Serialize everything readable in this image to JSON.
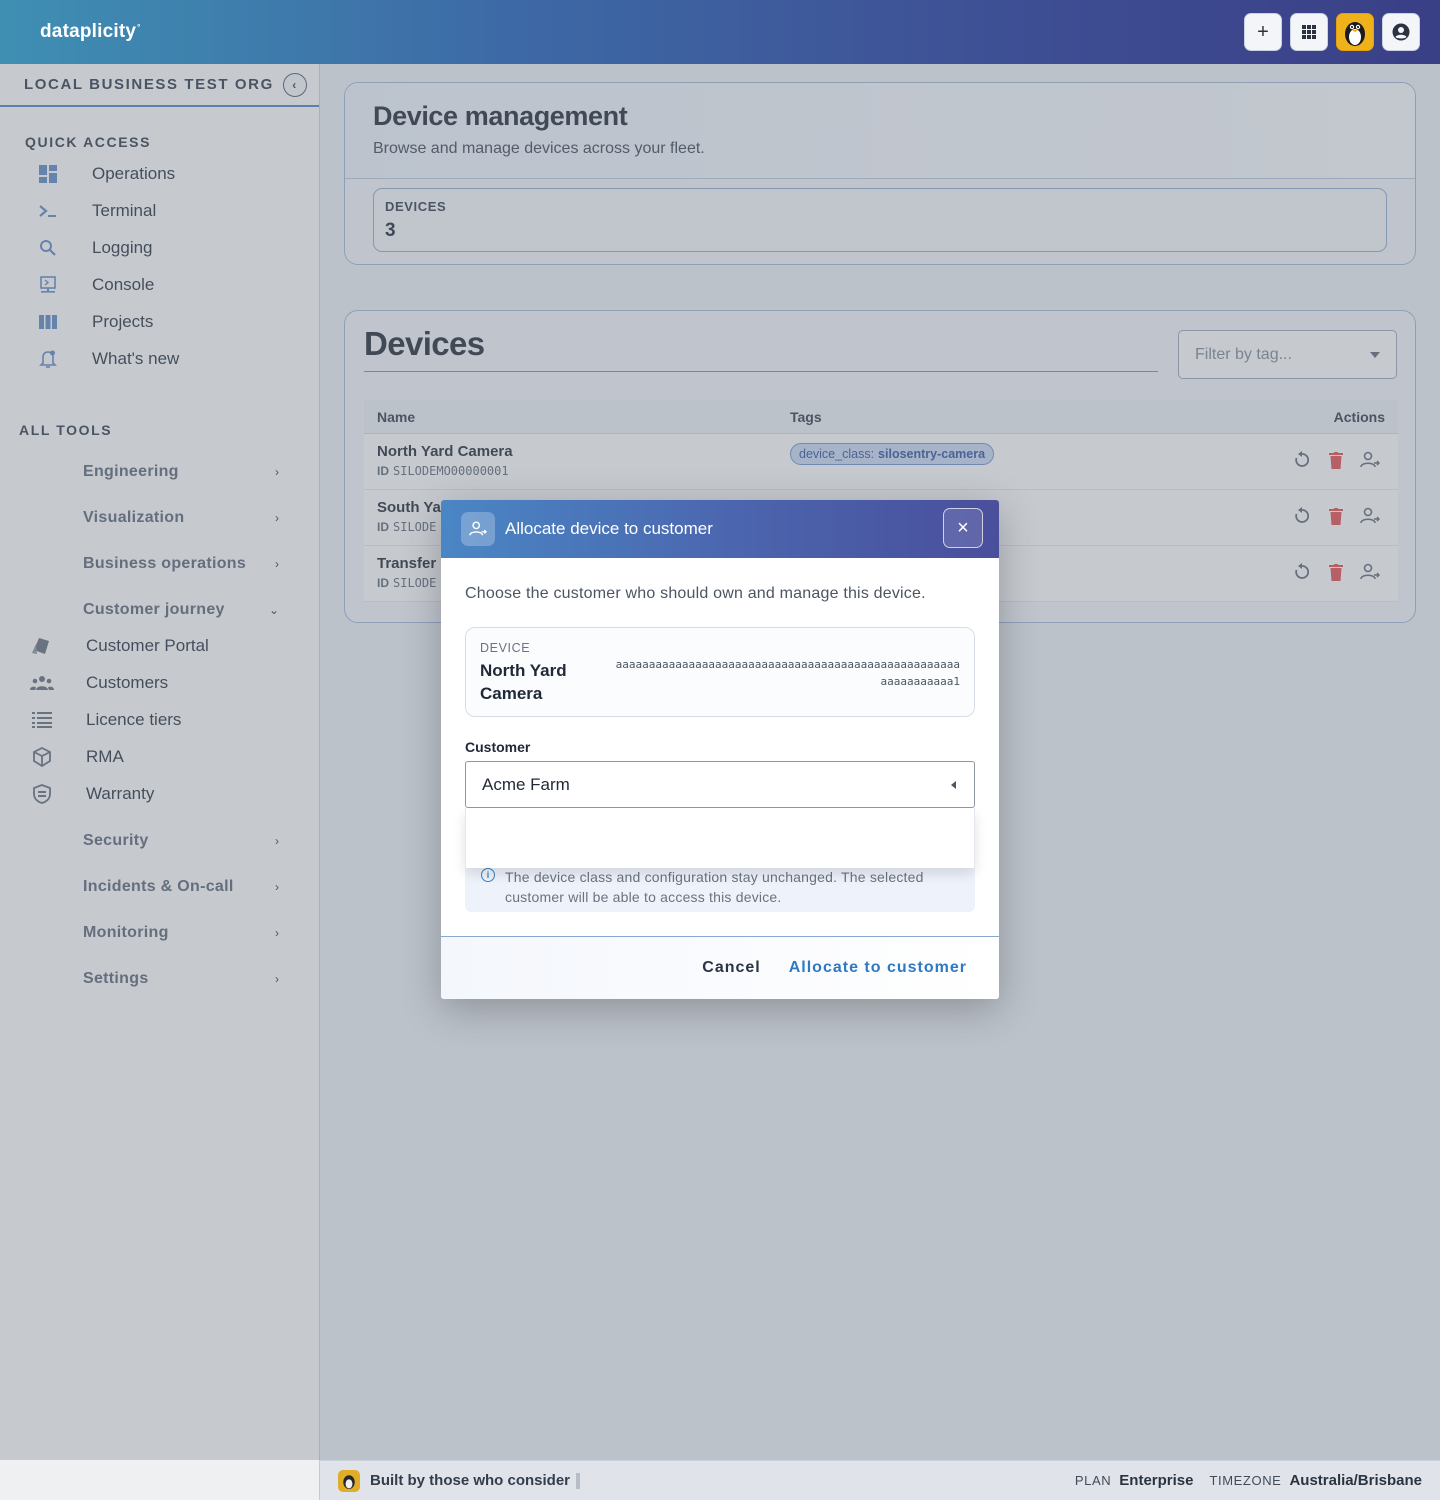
{
  "app": {
    "brand": "dataplicity",
    "brand_mark": "°"
  },
  "topbar": {
    "add_label": "+",
    "apps_icon": "grid-icon",
    "avatar_icon": "penguin-avatar",
    "account_icon": "user-circle-icon"
  },
  "sidebar": {
    "org_name": "LOCAL BUSINESS TEST ORG",
    "collapse_label": "‹",
    "quick_access_title": "QUICK ACCESS",
    "quick_access": [
      {
        "label": "Operations",
        "icon": "dashboard-icon"
      },
      {
        "label": "Terminal",
        "icon": "terminal-icon"
      },
      {
        "label": "Logging",
        "icon": "search-icon"
      },
      {
        "label": "Console",
        "icon": "console-icon"
      },
      {
        "label": "Projects",
        "icon": "columns-icon"
      },
      {
        "label": "What's new",
        "icon": "bell-icon"
      }
    ],
    "all_tools_title": "ALL TOOLS",
    "tools_top": [
      {
        "label": "Engineering"
      },
      {
        "label": "Visualization"
      },
      {
        "label": "Business operations"
      },
      {
        "label": "Customer journey"
      }
    ],
    "customer_journey_items": [
      {
        "label": "Customer Portal",
        "icon": "portal-icon"
      },
      {
        "label": "Customers",
        "icon": "people-icon"
      },
      {
        "label": "Licence tiers",
        "icon": "list-icon"
      },
      {
        "label": "RMA",
        "icon": "package-icon"
      },
      {
        "label": "Warranty",
        "icon": "shield-icon"
      }
    ],
    "tools_bottom": [
      {
        "label": "Security"
      },
      {
        "label": "Incidents & On-call"
      },
      {
        "label": "Monitoring"
      },
      {
        "label": "Settings"
      }
    ]
  },
  "device_management": {
    "title": "Device management",
    "subtitle": "Browse and manage devices across your fleet.",
    "devices_label": "DEVICES",
    "devices_count": "3"
  },
  "devices": {
    "title": "Devices",
    "filter_placeholder": "Filter by tag...",
    "columns": {
      "name": "Name",
      "tags": "Tags",
      "actions": "Actions"
    },
    "id_prefix": "ID",
    "rows": [
      {
        "name": "North Yard Camera",
        "id": "SILODEMO00000001",
        "tag_key": "device_class:",
        "tag_value": "silosentry-camera"
      },
      {
        "name": "South Ya",
        "id": "SILODE",
        "tag_key": "",
        "tag_value": ""
      },
      {
        "name": "Transfer",
        "id": "SILODE",
        "tag_key": "",
        "tag_value": ""
      }
    ]
  },
  "modal": {
    "title": "Allocate device to customer",
    "close_label": "×",
    "description": "Choose the customer who should own and manage this device.",
    "device_label": "DEVICE",
    "device_name": "North Yard Camera",
    "device_id": "aaaaaaaaaaaaaaaaaaaaaaaaaaaaaaaaaaaaaaaaaaaaaaaaaaaaaaaaaaaaaaa1",
    "customer_label": "Customer",
    "customer_value": "Acme Farm",
    "info_text": "The device class and configuration stay unchanged. The selected customer will be able to access this device.",
    "cancel_label": "Cancel",
    "confirm_label": "Allocate to customer"
  },
  "footer": {
    "tagline": "Built by those who consider",
    "plan_label": "PLAN",
    "plan_value": "Enterprise",
    "timezone_label": "TIMEZONE",
    "timezone_value": "Australia/Brisbane"
  },
  "colors": {
    "accent": "#2f79c4",
    "delete": "#e5484d",
    "tag_bg": "#c9d8f3"
  }
}
